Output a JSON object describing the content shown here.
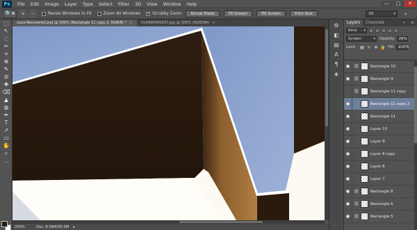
{
  "app": {
    "logo": "Ps",
    "menu": [
      "File",
      "Edit",
      "Image",
      "Layer",
      "Type",
      "Select",
      "Filter",
      "3D",
      "View",
      "Window",
      "Help"
    ],
    "window_controls": [
      "—",
      "□",
      "✕"
    ]
  },
  "options_bar": {
    "tool_icon": "zoom-tool",
    "tool_glyph": "🔍▾",
    "zoom_in_glyph": "+",
    "zoom_out_glyph": "−",
    "resize_windows_label": "Resize Windows to Fit",
    "resize_windows_checked": false,
    "zoom_all_label": "Zoom All Windows",
    "zoom_all_checked": false,
    "scrubby_label": "Scrubby Zoom",
    "scrubby_checked": true,
    "actual_pixels": "Actual Pixels",
    "fit_screen": "Fit Screen",
    "fill_screen": "Fill Screen",
    "print_size": "Print Size",
    "workspace": "3D",
    "search_glyph": "⌕"
  },
  "tools": [
    "⬚",
    "↖",
    "◌",
    "✂",
    "⌗",
    "⊕",
    "✎",
    "⊘",
    "✚",
    "⌫",
    "▲",
    "◍",
    "✒",
    "T",
    "↗",
    "▭",
    "✋",
    "⌕",
    "…"
  ],
  "colors": {
    "foreground": "#2a1a10",
    "background": "#ffffff",
    "selection": "#6d7f99",
    "sky": "#8ca2cc",
    "wall_dark": "#2b1b10",
    "wall_lit": "#a9773d"
  },
  "tabs": [
    {
      "label": "xxxx-Recovered.psd @ 200% (Rectangle 11 copy 2, RGB/8) *",
      "active": true,
      "close": "×"
    },
    {
      "label": "014998995587.jpg @ 300% (RGB/8#)",
      "active": false,
      "close": "×"
    }
  ],
  "status": {
    "zoom": "200%",
    "doc": "Doc: 8.58M/56.0M",
    "arrow": "▸"
  },
  "dock_icons": [
    "⚙",
    "◧",
    "▤",
    "A",
    "¶",
    "◈"
  ],
  "layers_panel": {
    "tabs": [
      "Layers",
      "Channels"
    ],
    "collapse_glyph": "»",
    "menu_glyph": "≡",
    "filter_kind": "Kind",
    "blend_mode": "Screen",
    "opacity_label": "Opacity:",
    "opacity": "26%",
    "lock_label": "Lock:",
    "fill_label": "Fill:",
    "fill": "100%",
    "eye_glyph": "●",
    "link_glyph": "⛓",
    "layers": [
      {
        "name": "Rectangle 10",
        "visible": true,
        "linked": true,
        "selected": false
      },
      {
        "name": "Rectangle 9",
        "visible": true,
        "linked": true,
        "selected": false
      },
      {
        "name": "Rectangle 11 copy",
        "visible": false,
        "linked": true,
        "selected": false
      },
      {
        "name": "Rectangle 11 copy 2",
        "visible": true,
        "linked": false,
        "selected": true
      },
      {
        "name": "Rectangle 11",
        "visible": true,
        "linked": false,
        "selected": false
      },
      {
        "name": "Layer 10",
        "visible": true,
        "linked": false,
        "selected": false
      },
      {
        "name": "Layer 9",
        "visible": true,
        "linked": false,
        "selected": false
      },
      {
        "name": "Layer 8 copy",
        "visible": true,
        "linked": false,
        "selected": false
      },
      {
        "name": "Layer 8",
        "visible": true,
        "linked": false,
        "selected": false
      },
      {
        "name": "Layer 7",
        "visible": true,
        "linked": false,
        "selected": false
      },
      {
        "name": "Rectangle 8",
        "visible": true,
        "linked": true,
        "selected": false
      },
      {
        "name": "Rectangle 6",
        "visible": true,
        "linked": true,
        "selected": false
      },
      {
        "name": "Rectangle 5",
        "visible": true,
        "linked": true,
        "selected": false
      }
    ]
  }
}
